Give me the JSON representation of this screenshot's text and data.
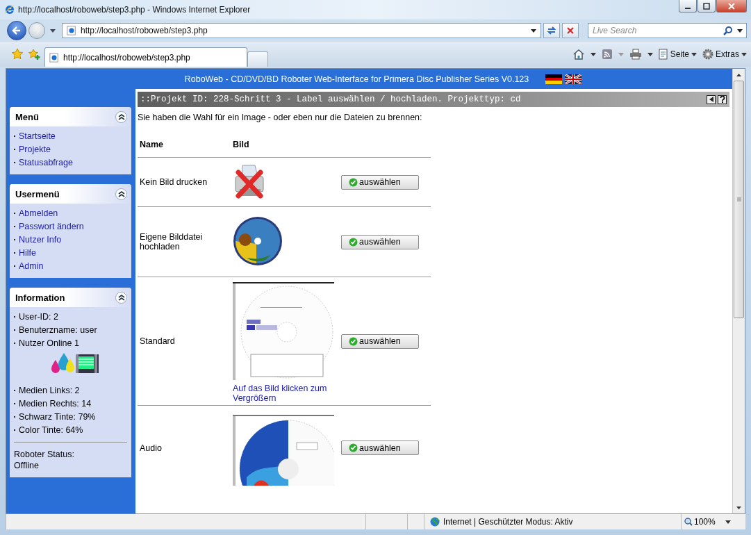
{
  "window": {
    "title": "http://localhost/roboweb/step3.php - Windows Internet Explorer"
  },
  "address_bar": {
    "url": "http://localhost/roboweb/step3.php",
    "search_placeholder": "Live Search"
  },
  "tabs": [
    {
      "label": "http://localhost/roboweb/step3.php",
      "selected": true
    }
  ],
  "command_bar": {
    "page_menu": "Seite",
    "tools_menu": "Extras"
  },
  "page": {
    "header": "RoboWeb - CD/DVD/BD Roboter Web-Interface for Primera Disc Publisher Series V0.123",
    "panels": [
      {
        "title": "Menü",
        "items": [
          {
            "kind": "link",
            "text": "Startseite"
          },
          {
            "kind": "link",
            "text": "Projekte"
          },
          {
            "kind": "link",
            "text": "Statusabfrage"
          }
        ]
      },
      {
        "title": "Usermenü",
        "items": [
          {
            "kind": "link",
            "text": "Abmelden"
          },
          {
            "kind": "link",
            "text": "Passwort ändern"
          },
          {
            "kind": "link",
            "text": "Nutzer Info"
          },
          {
            "kind": "link",
            "text": "Hilfe"
          },
          {
            "kind": "link",
            "text": "Admin"
          }
        ]
      },
      {
        "title": "Information",
        "items": [
          {
            "kind": "text",
            "text": "User-ID: 2"
          },
          {
            "kind": "text",
            "text": "Benuterzname: user"
          },
          {
            "kind": "text",
            "text": "Nutzer Online 1"
          },
          {
            "kind": "ink"
          },
          {
            "kind": "text",
            "text": "Medien Links: 2"
          },
          {
            "kind": "text",
            "text": "Medien Rechts: 14"
          },
          {
            "kind": "text",
            "text": "Schwarz Tinte: 79%"
          },
          {
            "kind": "text",
            "text": "Color Tinte: 64%"
          },
          {
            "kind": "status",
            "text": "Roboter Status:"
          },
          {
            "kind": "plain",
            "text": "Offline"
          }
        ]
      }
    ],
    "content": {
      "title": "::Projekt ID: 228-Schritt 3 - Label auswählen / hochladen. Projekttyp: cd",
      "intro": "Sie haben die Wahl für ein Image - oder eben nur die Dateien zu brennen:",
      "columns": [
        "Name",
        "Bild"
      ],
      "rows": [
        {
          "kind": "icon",
          "name": "Kein Bild drucken",
          "button": "auswählen"
        },
        {
          "kind": "disc",
          "name": "Eigene Bilddatei hochladen",
          "button": "auswählen"
        },
        {
          "kind": "label",
          "name": "Standard",
          "link": "Auf das Bild klicken zum Vergrößern",
          "button": "auswählen"
        },
        {
          "kind": "label_cut",
          "name": "Audio",
          "button": "auswählen"
        }
      ]
    }
  },
  "status_bar": {
    "zone": "Internet | Geschützter Modus: Aktiv",
    "zoom": "100%"
  }
}
